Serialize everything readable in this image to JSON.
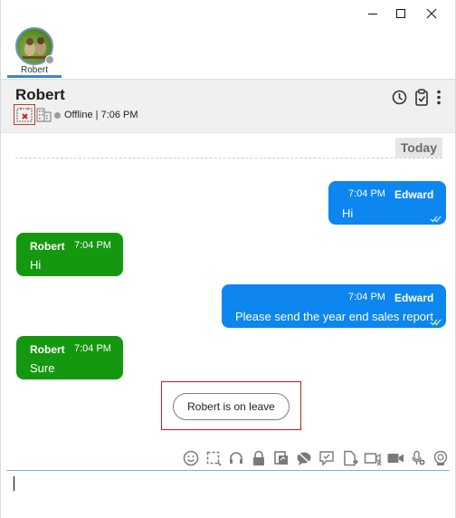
{
  "window": {
    "controls": [
      "minimize",
      "maximize",
      "close"
    ]
  },
  "tabs": [
    {
      "label": "Robert",
      "status": "offline"
    }
  ],
  "header": {
    "contact_name": "Robert",
    "status_text": "Offline | 7:06 PM",
    "icons": [
      "calendar-remove-icon",
      "building-icon",
      "history-icon",
      "clipboard-check-icon",
      "more-vertical-icon"
    ]
  },
  "day_divider": "Today",
  "messages": [
    {
      "direction": "out",
      "sender": "Edward",
      "time": "7:04 PM",
      "text": "Hi",
      "read": true
    },
    {
      "direction": "in",
      "sender": "Robert",
      "time": "7:04 PM",
      "text": "Hi"
    },
    {
      "direction": "out",
      "sender": "Edward",
      "time": "7:04 PM",
      "text": "Please send the year end sales report",
      "read": true
    },
    {
      "direction": "in",
      "sender": "Robert",
      "time": "7:04 PM",
      "text": "Sure"
    }
  ],
  "notice": "Robert is on leave",
  "toolbar_icons": [
    "emoji-icon",
    "screenshot-icon",
    "headset-icon",
    "lock-icon",
    "screen-share-icon",
    "mute-chat-icon",
    "task-icon",
    "file-transfer-icon",
    "video-message-icon",
    "video-call-icon",
    "audio-message-icon",
    "assistant-icon"
  ],
  "colors": {
    "outgoing_bubble": "#0d86ef",
    "incoming_bubble": "#14980f",
    "highlight_box": "#c9191f",
    "tab_underline": "#3a86d8"
  }
}
